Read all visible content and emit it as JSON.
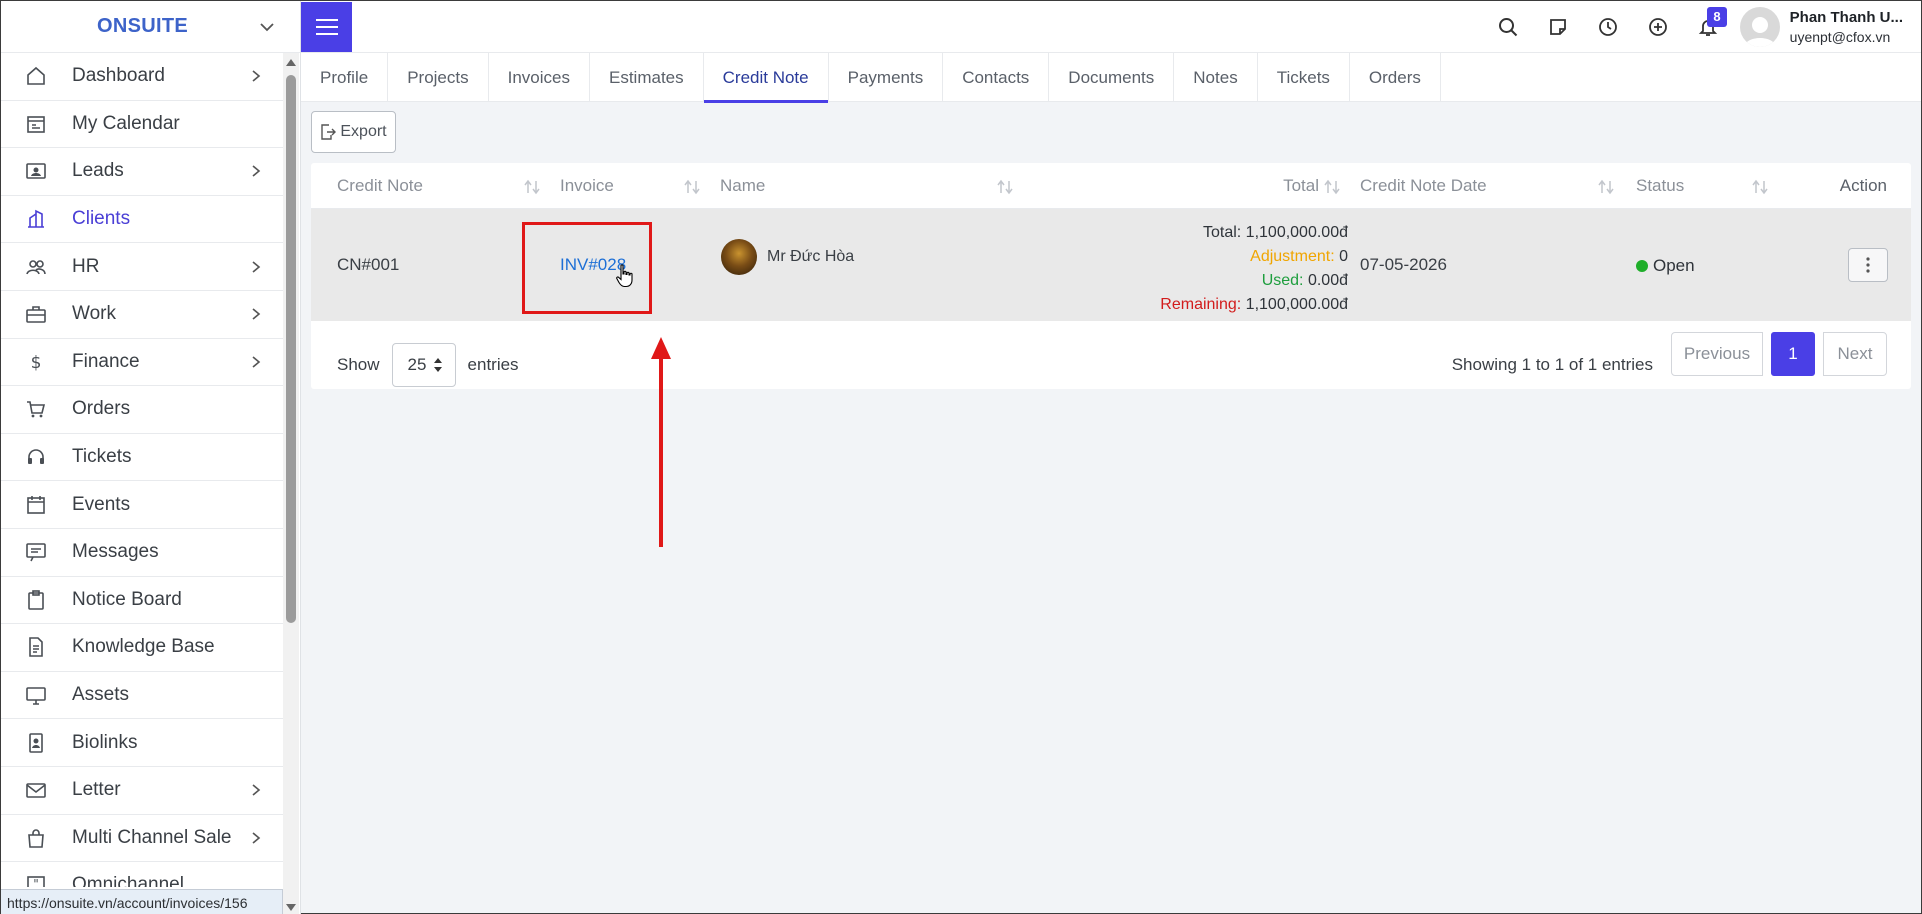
{
  "brand": {
    "name": "ONSUITE"
  },
  "sidebar": {
    "items": [
      {
        "label": "Dashboard",
        "icon": "home-icon",
        "has_submenu": true
      },
      {
        "label": "My Calendar",
        "icon": "calendar-icon",
        "has_submenu": false
      },
      {
        "label": "Leads",
        "icon": "id-card-icon",
        "has_submenu": true
      },
      {
        "label": "Clients",
        "icon": "building-icon",
        "has_submenu": false,
        "active": true
      },
      {
        "label": "HR",
        "icon": "people-icon",
        "has_submenu": true
      },
      {
        "label": "Work",
        "icon": "briefcase-icon",
        "has_submenu": true
      },
      {
        "label": "Finance",
        "icon": "dollar-icon",
        "has_submenu": true
      },
      {
        "label": "Orders",
        "icon": "cart-icon",
        "has_submenu": false
      },
      {
        "label": "Tickets",
        "icon": "headset-icon",
        "has_submenu": false
      },
      {
        "label": "Events",
        "icon": "event-calendar-icon",
        "has_submenu": false
      },
      {
        "label": "Messages",
        "icon": "message-icon",
        "has_submenu": false
      },
      {
        "label": "Notice Board",
        "icon": "clipboard-icon",
        "has_submenu": false
      },
      {
        "label": "Knowledge Base",
        "icon": "document-icon",
        "has_submenu": false
      },
      {
        "label": "Assets",
        "icon": "monitor-icon",
        "has_submenu": false
      },
      {
        "label": "Biolinks",
        "icon": "badge-icon",
        "has_submenu": false
      },
      {
        "label": "Letter",
        "icon": "envelope-icon",
        "has_submenu": true
      },
      {
        "label": "Multi Channel Sale",
        "icon": "bag-icon",
        "has_submenu": true
      },
      {
        "label": "Omnichannel",
        "icon": "quote-icon",
        "has_submenu": false
      }
    ]
  },
  "status_bar": {
    "url": "https://onsuite.vn/account/invoices/156"
  },
  "topbar": {
    "notification_count": "8",
    "user": {
      "name": "Phan Thanh U...",
      "email": "uyenpt@cfox.vn"
    }
  },
  "tabs": [
    {
      "label": "Profile"
    },
    {
      "label": "Projects"
    },
    {
      "label": "Invoices"
    },
    {
      "label": "Estimates"
    },
    {
      "label": "Credit Note",
      "active": true
    },
    {
      "label": "Payments"
    },
    {
      "label": "Contacts"
    },
    {
      "label": "Documents"
    },
    {
      "label": "Notes"
    },
    {
      "label": "Tickets"
    },
    {
      "label": "Orders"
    }
  ],
  "toolbar": {
    "export_label": "Export"
  },
  "table": {
    "headers": {
      "credit_note": "Credit Note",
      "invoice": "Invoice",
      "name": "Name",
      "total": "Total",
      "credit_note_date": "Credit Note Date",
      "status": "Status",
      "action": "Action"
    },
    "rows": [
      {
        "credit_note": "CN#001",
        "invoice": "INV#028",
        "name": "Mr Đức Hòa",
        "total_label": "Total:",
        "total_value": "1,100,000.00đ",
        "adjustment_label": "Adjustment:",
        "adjustment_value": "0",
        "used_label": "Used:",
        "used_value": "0.00đ",
        "remaining_label": "Remaining:",
        "remaining_value": "1,100,000.00đ",
        "date": "07-05-2026",
        "status": "Open",
        "status_color": "#1fae2a"
      }
    ]
  },
  "footer": {
    "show_label": "Show",
    "page_size": "25",
    "entries_label": "entries",
    "showing_text": "Showing 1 to 1 of 1 entries",
    "prev_label": "Previous",
    "current_page": "1",
    "next_label": "Next"
  },
  "colors": {
    "accent": "#4a3fe6",
    "brand": "#3d63c9",
    "link": "#1d6fd6",
    "annotation": "#e01818"
  }
}
